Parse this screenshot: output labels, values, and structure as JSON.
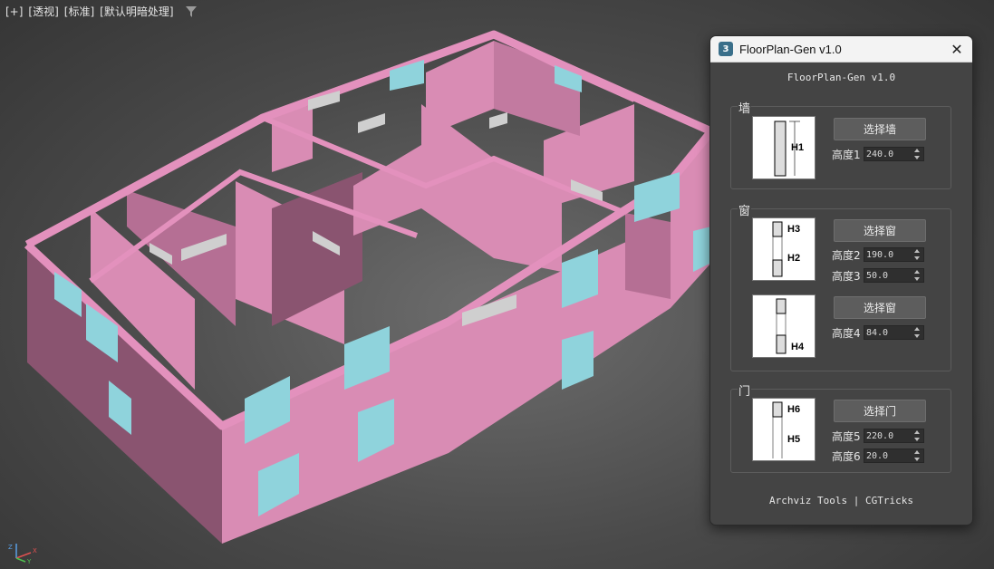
{
  "viewport": {
    "labels": [
      "[+]",
      "[透视]",
      "[标准]",
      "[默认明暗处理]"
    ],
    "filter_icon": "filter-icon",
    "axis": {
      "x": "X",
      "y": "Y",
      "z": "Z"
    },
    "colors": {
      "wall": "#d98cb4",
      "wall_top": "#e391bd",
      "wall_dark": "#7a4a63",
      "window": "#8fd3dc",
      "lintel": "#cfcfcf"
    }
  },
  "panel": {
    "window_title": "FloorPlan-Gen v1.0",
    "app_icon_text": "3",
    "heading": "FloorPlan-Gen v1.0",
    "footer": "Archviz Tools | CGTricks",
    "wall": {
      "title": "墙",
      "button": "选择墙",
      "thumb_labels": [
        "H1"
      ],
      "fields": [
        {
          "label": "高度1",
          "value": "240.0"
        }
      ]
    },
    "window": {
      "title": "窗",
      "button1": "选择窗",
      "thumb1_labels": [
        "H3",
        "H2"
      ],
      "fields1": [
        {
          "label": "高度2",
          "value": "190.0"
        },
        {
          "label": "高度3",
          "value": "50.0"
        }
      ],
      "button2": "选择窗",
      "thumb2_labels": [
        "H4"
      ],
      "fields2": [
        {
          "label": "高度4",
          "value": "84.0"
        }
      ]
    },
    "door": {
      "title": "门",
      "button": "选择门",
      "thumb_labels": [
        "H6",
        "H5"
      ],
      "fields": [
        {
          "label": "高度5",
          "value": "220.0"
        },
        {
          "label": "高度6",
          "value": "20.0"
        }
      ]
    }
  }
}
